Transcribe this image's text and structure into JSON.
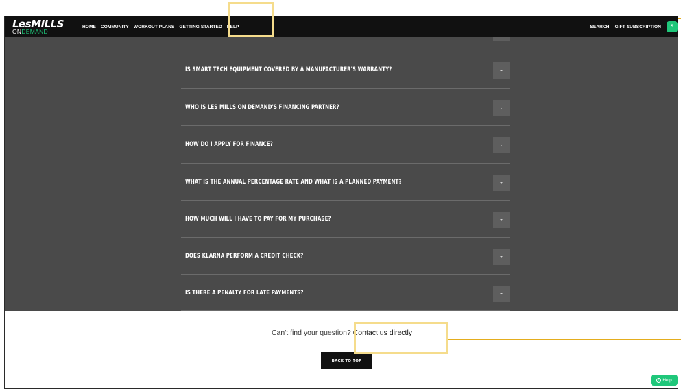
{
  "header": {
    "logo_top": "LesMILLS",
    "logo_on": "ON",
    "logo_demand": "DEMAND",
    "nav": [
      "HOME",
      "COMMUNITY",
      "WORKOUT PLANS",
      "GETTING STARTED",
      "HELP"
    ],
    "search": "SEARCH",
    "gift": "GIFT SUBSCRIPTION",
    "avatar": "S"
  },
  "faq": {
    "questions": [
      "IS SMART TECH EQUIPMENT COVERED BY A MANUFACTURER'S WARRANTY?",
      "WHO IS LES MILLS ON DEMAND'S FINANCING PARTNER?",
      "HOW DO I APPLY FOR FINANCE?",
      "WHAT IS THE ANNUAL PERCENTAGE RATE AND WHAT IS A PLANNED PAYMENT?",
      "HOW MUCH WILL I HAVE TO PAY FOR MY PURCHASE?",
      "DOES KLARNA PERFORM A CREDIT CHECK?",
      "IS THERE A PENALTY FOR LATE PAYMENTS?"
    ]
  },
  "footer": {
    "prompt": "Can't find your question?",
    "contact_link": "Contact us directly",
    "back_to_top": "BACK TO TOP",
    "help_widget": "Help"
  },
  "colors": {
    "header_bg": "#111111",
    "faq_bg": "#4a4a4a",
    "accent_green": "#1fc77a",
    "highlight": "#f5dc8c"
  }
}
